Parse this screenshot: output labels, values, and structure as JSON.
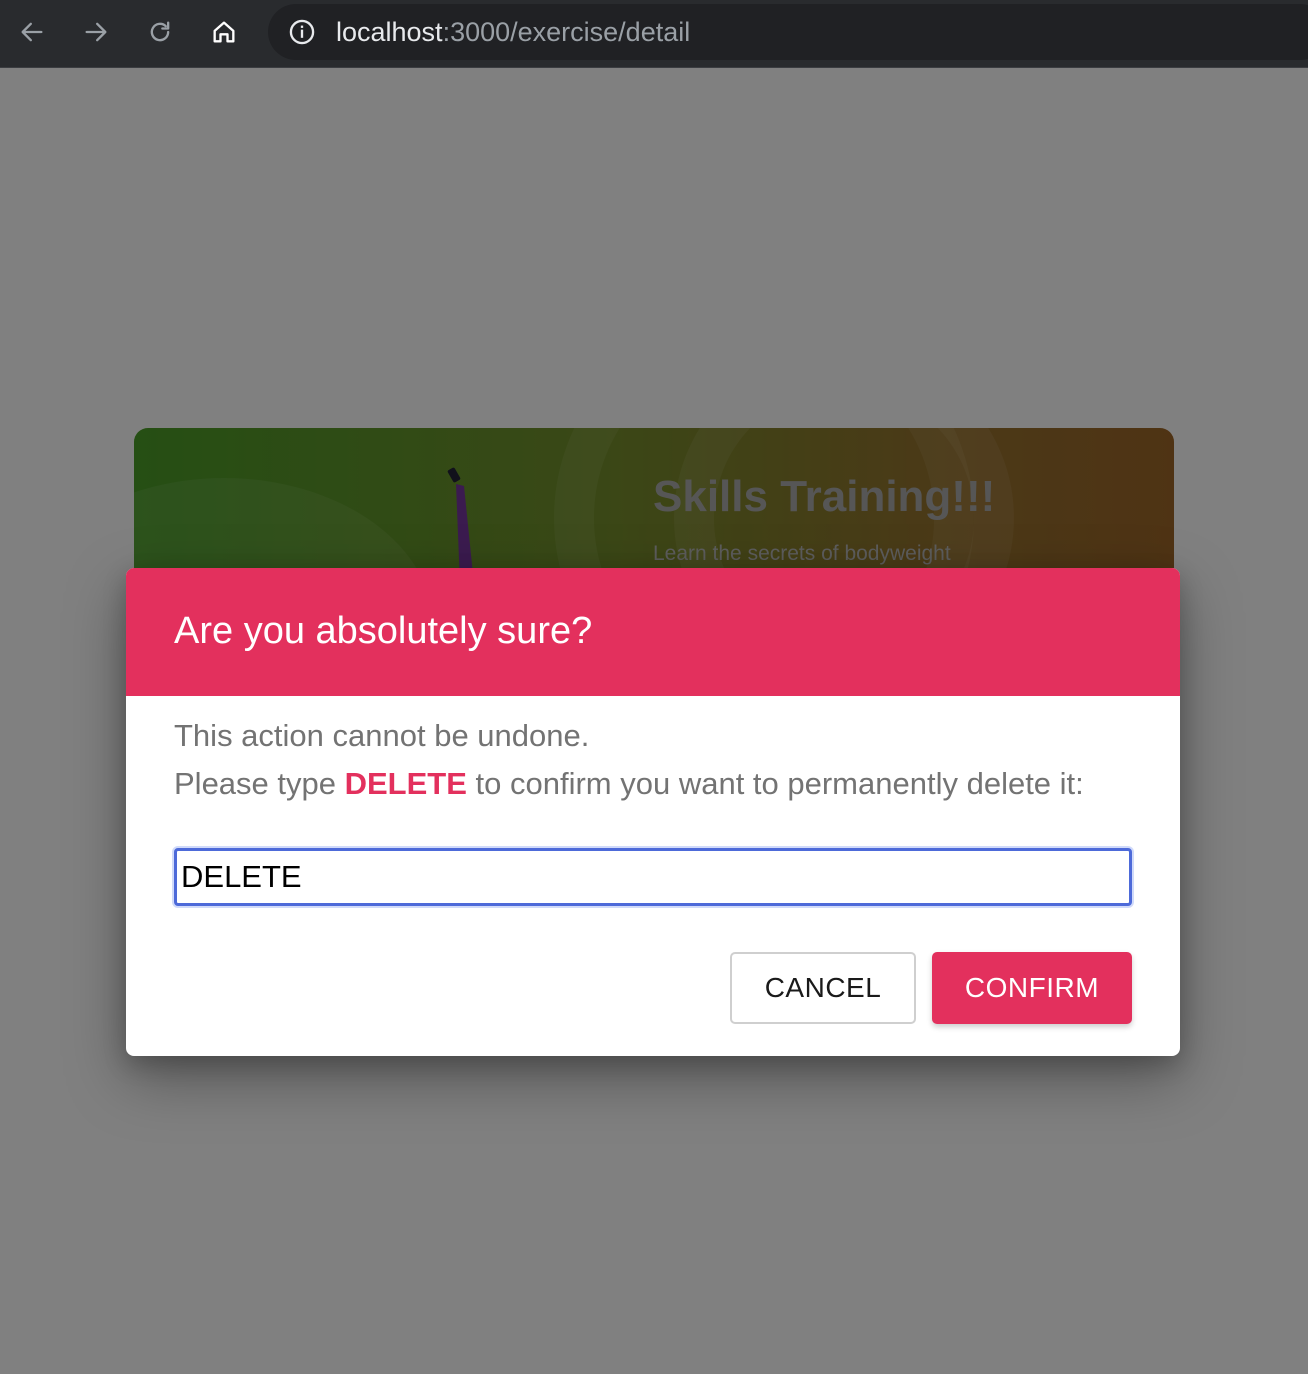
{
  "browser": {
    "url_host": "localhost",
    "url_path": ":3000/exercise/detail",
    "icons": [
      "back-arrow-icon",
      "forward-arrow-icon",
      "reload-icon",
      "home-icon",
      "info-icon"
    ]
  },
  "hero": {
    "title": "Skills Training!!!",
    "subtitle": "Learn the secrets of bodyweight"
  },
  "dialog": {
    "title": "Are you absolutely sure?",
    "message_line1": "This action cannot be undone.",
    "message_line2_prefix": "Please type ",
    "message_line2_keyword": "DELETE",
    "message_line2_suffix": " to confirm you want to permanently delete it:",
    "input_value": "DELETE",
    "cancel_label": "CANCEL",
    "confirm_label": "CONFIRM"
  },
  "colors": {
    "accent": "#e3305d",
    "overlay": "#808080",
    "toolbar": "#292b2e",
    "input_focus": "#4d6ad9"
  }
}
